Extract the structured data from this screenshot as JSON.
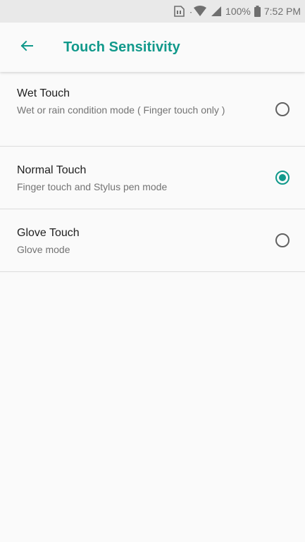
{
  "status_bar": {
    "battery_percent": "100%",
    "time": "7:52 PM",
    "icons": [
      "sim-card-icon",
      "wifi-icon",
      "cell-signal-icon",
      "battery-icon"
    ]
  },
  "app_bar": {
    "title": "Touch Sensitivity",
    "back_icon": "arrow-back-icon"
  },
  "colors": {
    "accent": "#11998b",
    "background": "#fafafa",
    "status_bar": "#e9e9e9",
    "divider": "#dcdcdc"
  },
  "options": [
    {
      "title": "Wet Touch",
      "summary": "Wet or rain condition mode ( Finger touch only )",
      "selected": false
    },
    {
      "title": "Normal Touch",
      "summary": "Finger touch and Stylus pen mode",
      "selected": true
    },
    {
      "title": "Glove Touch",
      "summary": "Glove mode",
      "selected": false
    }
  ]
}
